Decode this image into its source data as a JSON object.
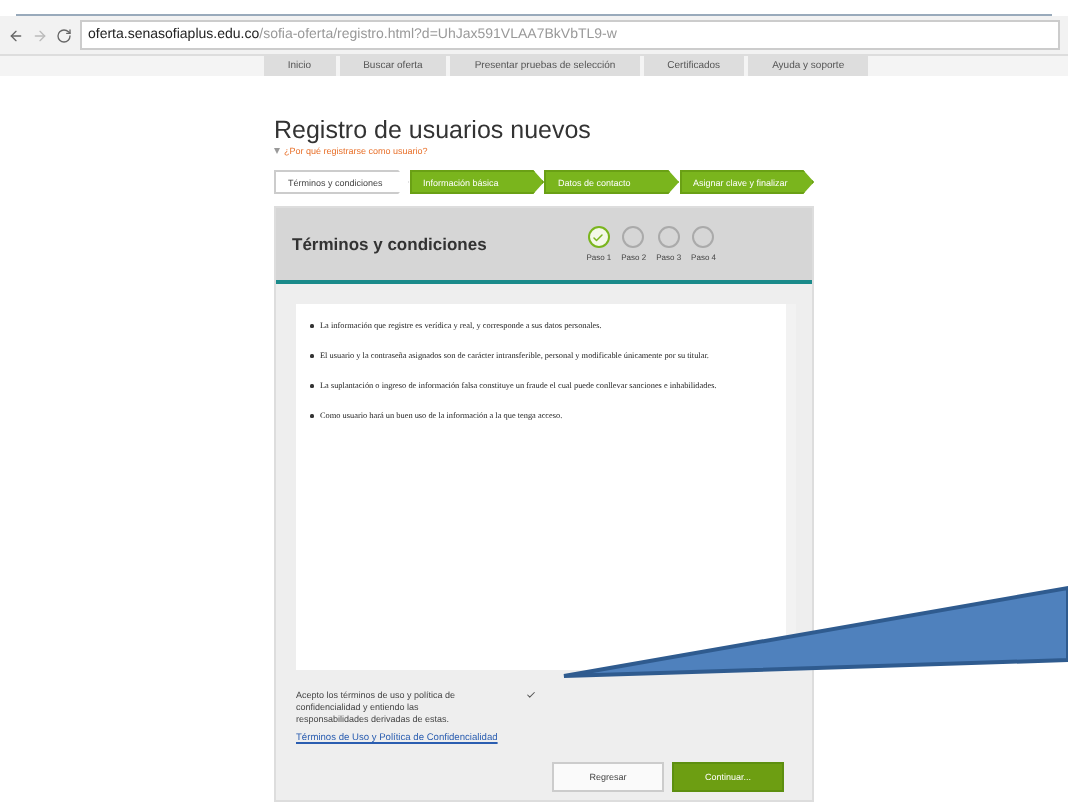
{
  "browser": {
    "url_host": "oferta.senasofiaplus.edu.co",
    "url_path": "/sofia-oferta/registro.html?d=UhJax591VLAA7BkVbTL9-w"
  },
  "nav": [
    "Inicio",
    "Buscar oferta",
    "Presentar pruebas de selección",
    "Certificados",
    "Ayuda y soporte"
  ],
  "page": {
    "title": "Registro de usuarios nuevos",
    "help_link": "¿Por qué registrarse como usuario?"
  },
  "wizard": [
    {
      "label": "Términos y condiciones",
      "selected": true
    },
    {
      "label": "Información básica",
      "selected": false
    },
    {
      "label": "Datos de contacto",
      "selected": false
    },
    {
      "label": "Asignar clave y finalizar",
      "selected": false
    }
  ],
  "panel": {
    "title": "Términos y condiciones",
    "steps": [
      {
        "label": "Paso 1",
        "done": true
      },
      {
        "label": "Paso 2",
        "done": false
      },
      {
        "label": "Paso 3",
        "done": false
      },
      {
        "label": "Paso 4",
        "done": false
      }
    ],
    "terms": [
      "La información que registre es verídica y real, y corresponde a sus datos personales.",
      "El usuario y la contraseña asignados son de carácter intransferible, personal y modificable únicamente por su titular.",
      "La suplantación o ingreso de información falsa constituye un fraude el cual puede conllevar sanciones e inhabilidades.",
      "Como usuario hará un buen uso de la información a la que tenga acceso."
    ],
    "accept": {
      "label": "Acepto los términos de uso y política de confidencialidad y entiendo las responsabilidades derivadas de estas.",
      "checked": true
    },
    "policy_link": "Términos de Uso y Política de Confidencialidad",
    "buttons": [
      {
        "label": "Regresar",
        "kind": "secondary"
      },
      {
        "label": "Continuar...",
        "kind": "primary"
      }
    ]
  }
}
